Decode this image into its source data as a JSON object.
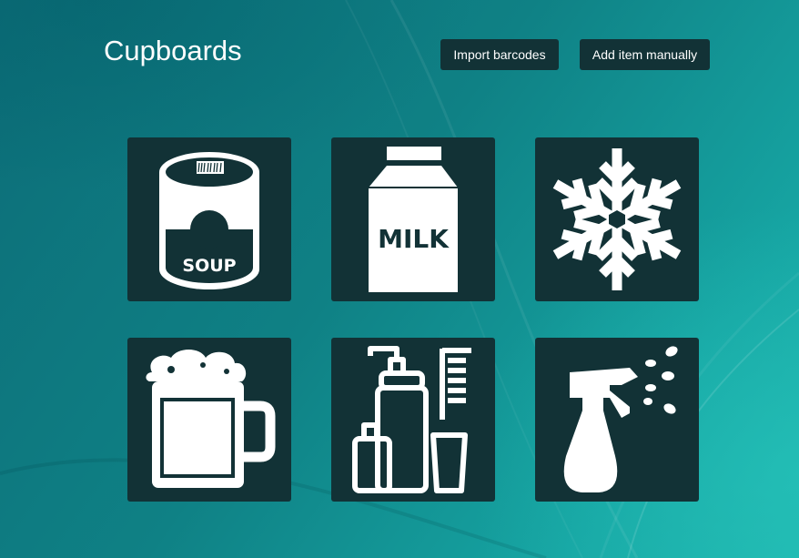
{
  "header": {
    "title": "Cupboards",
    "import_label": "Import barcodes",
    "add_label": "Add item manually"
  },
  "categories": [
    {
      "icon": "soup-can-icon",
      "label": "SOUP"
    },
    {
      "icon": "milk-carton-icon",
      "label": "MILK"
    },
    {
      "icon": "snowflake-icon"
    },
    {
      "icon": "beer-mug-icon"
    },
    {
      "icon": "toiletries-icon"
    },
    {
      "icon": "spray-bottle-icon"
    }
  ],
  "colors": {
    "tile_background": "#123236",
    "button_background": "#123236",
    "icon": "#ffffff",
    "page_teal": "#0f8185"
  }
}
